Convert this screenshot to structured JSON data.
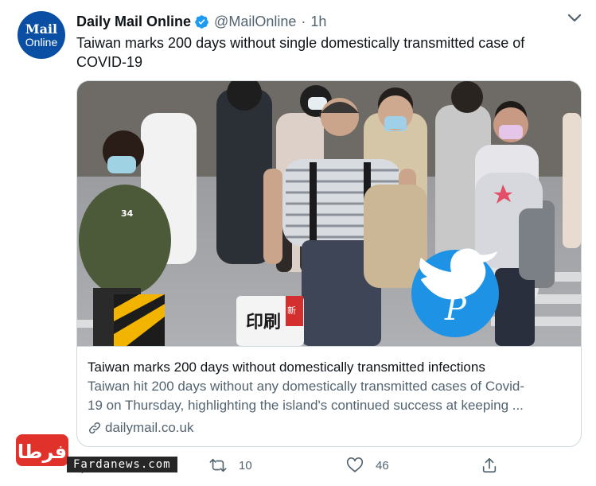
{
  "tweet": {
    "avatar": {
      "line1": "Mail",
      "line2": "Online"
    },
    "author_name": "Daily Mail Online",
    "handle": "@MailOnline",
    "separator": "·",
    "time": "1h",
    "text": "Taiwan marks 200 days without single domestically transmitted case of COVID-19"
  },
  "card": {
    "title": "Taiwan marks 200 days without domestically transmitted infections",
    "description_line1": "Taiwan hit 200 days without any domestically transmitted cases of Covid-",
    "description_line2": "19 on Thursday, highlighting the island's continued success at keeping ...",
    "domain": "dailymail.co.uk",
    "photo_text": {
      "shirt_number": "34",
      "bag_text": "印刷",
      "bag_red_tag": "新"
    }
  },
  "actions": {
    "reply_count": "",
    "retweet_count": "10",
    "like_count": "46"
  },
  "watermark": {
    "text": "Fardanews.com",
    "logo_text": "فرطا"
  },
  "colors": {
    "text": "#0f1419",
    "secondary": "#536471",
    "border": "#cfd9de",
    "verified": "#1d9bf0",
    "avatar_bg": "#0a4fa3",
    "watermark_red": "#e0312b"
  },
  "icons": [
    "verified-badge-icon",
    "chevron-down-icon",
    "link-icon",
    "reply-icon",
    "retweet-icon",
    "like-icon",
    "share-icon",
    "twitter-bird-icon"
  ]
}
